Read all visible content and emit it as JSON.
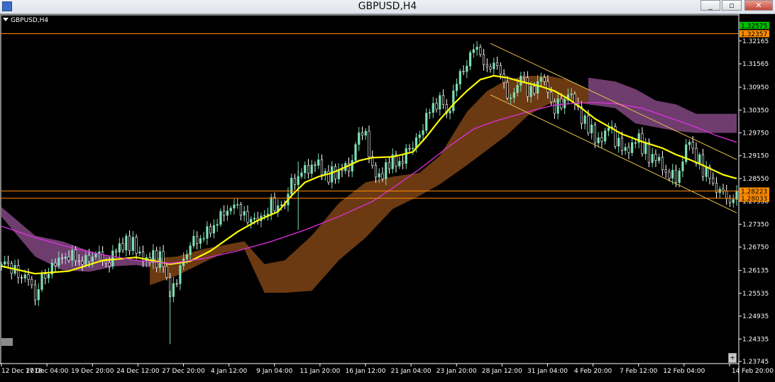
{
  "window": {
    "title": "GBPUSD,H4",
    "minimize_label": "_",
    "restore_label": "▫",
    "close_label": "✕"
  },
  "chart_label": "GBPUSD,H4",
  "scroll_label": "+",
  "colors": {
    "background": "#000000",
    "bull": "#7ddfb3",
    "bear": "#ffffff",
    "ma_fast": "#ffff00",
    "ma_slow": "#e030e0",
    "kumo_bull": "#6b3a12",
    "kumo_bear": "#6e3d6e",
    "channel": "#e8c24a",
    "hline": "#ff8c00",
    "axis_text": "#ffffff"
  },
  "chart_data": {
    "type": "candlestick",
    "title": "GBPUSD,H4",
    "ylim": [
      1.23745,
      1.3272
    ],
    "y_ticks": [
      "1.32165",
      "1.31565",
      "1.30950",
      "1.30350",
      "1.29750",
      "1.29150",
      "1.28550",
      "1.27950",
      "1.27350",
      "1.26750",
      "1.26135",
      "1.25535",
      "1.24935",
      "1.24335",
      "1.23745"
    ],
    "x_ticks": [
      "12 Dec 2018",
      "17 Dec 04:00",
      "19 Dec 20:00",
      "24 Dec 12:00",
      "27 Dec 20:00",
      "4 Jan 12:00",
      "9 Jan 04:00",
      "11 Jan 20:00",
      "16 Jan 12:00",
      "21 Jan 04:00",
      "23 Jan 20:00",
      "28 Jan 12:00",
      "31 Jan 04:00",
      "4 Feb 20:00",
      "7 Feb 12:00",
      "12 Feb 04:00",
      "14 Feb 20:00"
    ],
    "price_labels": [
      {
        "value": 1.32575,
        "text": "1.32575",
        "color": "#00c000"
      },
      {
        "value": 1.32357,
        "text": "1.32357",
        "color": "#ff8c00"
      },
      {
        "value": 1.28223,
        "text": "1.28223",
        "color": "#ff8c00"
      },
      {
        "value": 1.28033,
        "text": "1.28033",
        "color": "#ff8c00"
      }
    ],
    "hlines": [
      1.32357,
      1.28223,
      1.28033
    ],
    "close_path": [
      [
        0,
        1.263
      ],
      [
        4,
        1.2615
      ],
      [
        8,
        1.258
      ],
      [
        10,
        1.2545
      ],
      [
        12,
        1.2595
      ],
      [
        16,
        1.262
      ],
      [
        20,
        1.2655
      ],
      [
        24,
        1.264
      ],
      [
        28,
        1.266
      ],
      [
        32,
        1.263
      ],
      [
        36,
        1.269
      ],
      [
        40,
        1.2675
      ],
      [
        44,
        1.2645
      ],
      [
        48,
        1.264
      ],
      [
        50,
        1.256
      ],
      [
        52,
        1.26
      ],
      [
        56,
        1.268
      ],
      [
        60,
        1.27
      ],
      [
        64,
        1.274
      ],
      [
        68,
        1.279
      ],
      [
        72,
        1.276
      ],
      [
        76,
        1.273
      ],
      [
        80,
        1.279
      ],
      [
        84,
        1.277
      ],
      [
        86,
        1.284
      ],
      [
        90,
        1.288
      ],
      [
        94,
        1.291
      ],
      [
        96,
        1.2855
      ],
      [
        100,
        1.288
      ],
      [
        104,
        1.29
      ],
      [
        106,
        1.298
      ],
      [
        108,
        1.296
      ],
      [
        110,
        1.2885
      ],
      [
        112,
        1.2845
      ],
      [
        114,
        1.289
      ],
      [
        118,
        1.29
      ],
      [
        122,
        1.294
      ],
      [
        126,
        1.301
      ],
      [
        130,
        1.307
      ],
      [
        132,
        1.3025
      ],
      [
        136,
        1.312
      ],
      [
        140,
        1.32
      ],
      [
        144,
        1.316
      ],
      [
        148,
        1.314
      ],
      [
        150,
        1.306
      ],
      [
        154,
        1.313
      ],
      [
        156,
        1.308
      ],
      [
        160,
        1.311
      ],
      [
        164,
        1.304
      ],
      [
        168,
        1.307
      ],
      [
        172,
        1.302
      ],
      [
        176,
        1.296
      ],
      [
        180,
        1.299
      ],
      [
        184,
        1.293
      ],
      [
        188,
        1.296
      ],
      [
        192,
        1.292
      ],
      [
        196,
        1.288
      ],
      [
        200,
        1.2855
      ],
      [
        204,
        1.295
      ],
      [
        208,
        1.288
      ],
      [
        212,
        1.283
      ],
      [
        216,
        1.2795
      ],
      [
        218,
        1.281
      ]
    ],
    "series": [
      {
        "name": "MA fast",
        "values": [
          [
            0,
            1.2625
          ],
          [
            10,
            1.2605
          ],
          [
            20,
            1.2612
          ],
          [
            30,
            1.264
          ],
          [
            40,
            1.2648
          ],
          [
            50,
            1.263
          ],
          [
            56,
            1.2638
          ],
          [
            62,
            1.2665
          ],
          [
            70,
            1.2715
          ],
          [
            76,
            1.2745
          ],
          [
            82,
            1.2768
          ],
          [
            86,
            1.281
          ],
          [
            90,
            1.2845
          ],
          [
            94,
            1.286
          ],
          [
            98,
            1.287
          ],
          [
            102,
            1.2885
          ],
          [
            106,
            1.2902
          ],
          [
            110,
            1.291
          ],
          [
            116,
            1.2912
          ],
          [
            122,
            1.2925
          ],
          [
            126,
            1.2965
          ],
          [
            130,
            1.301
          ],
          [
            134,
            1.305
          ],
          [
            138,
            1.3085
          ],
          [
            142,
            1.3115
          ],
          [
            146,
            1.3125
          ],
          [
            150,
            1.312
          ],
          [
            154,
            1.311
          ],
          [
            160,
            1.3097
          ],
          [
            164,
            1.3085
          ],
          [
            168,
            1.3065
          ],
          [
            172,
            1.304
          ],
          [
            176,
            1.3012
          ],
          [
            180,
            1.2992
          ],
          [
            184,
            1.2972
          ],
          [
            190,
            1.2952
          ],
          [
            196,
            1.2935
          ],
          [
            200,
            1.2918
          ],
          [
            204,
            1.2905
          ],
          [
            208,
            1.289
          ],
          [
            214,
            1.2865
          ],
          [
            218,
            1.2855
          ]
        ]
      },
      {
        "name": "MA slow",
        "values": [
          [
            0,
            1.273
          ],
          [
            10,
            1.27
          ],
          [
            20,
            1.2675
          ],
          [
            30,
            1.2655
          ],
          [
            40,
            1.264
          ],
          [
            50,
            1.2632
          ],
          [
            60,
            1.2645
          ],
          [
            70,
            1.2665
          ],
          [
            80,
            1.269
          ],
          [
            90,
            1.272
          ],
          [
            100,
            1.2755
          ],
          [
            110,
            1.2795
          ],
          [
            116,
            1.283
          ],
          [
            124,
            1.288
          ],
          [
            132,
            1.2935
          ],
          [
            140,
            1.2985
          ],
          [
            146,
            1.3005
          ],
          [
            152,
            1.302
          ],
          [
            158,
            1.3035
          ],
          [
            164,
            1.3048
          ],
          [
            170,
            1.3053
          ],
          [
            176,
            1.3055
          ],
          [
            182,
            1.3052
          ],
          [
            190,
            1.304
          ],
          [
            198,
            1.3015
          ],
          [
            206,
            1.299
          ],
          [
            212,
            1.2968
          ],
          [
            218,
            1.295
          ]
        ]
      }
    ]
  }
}
